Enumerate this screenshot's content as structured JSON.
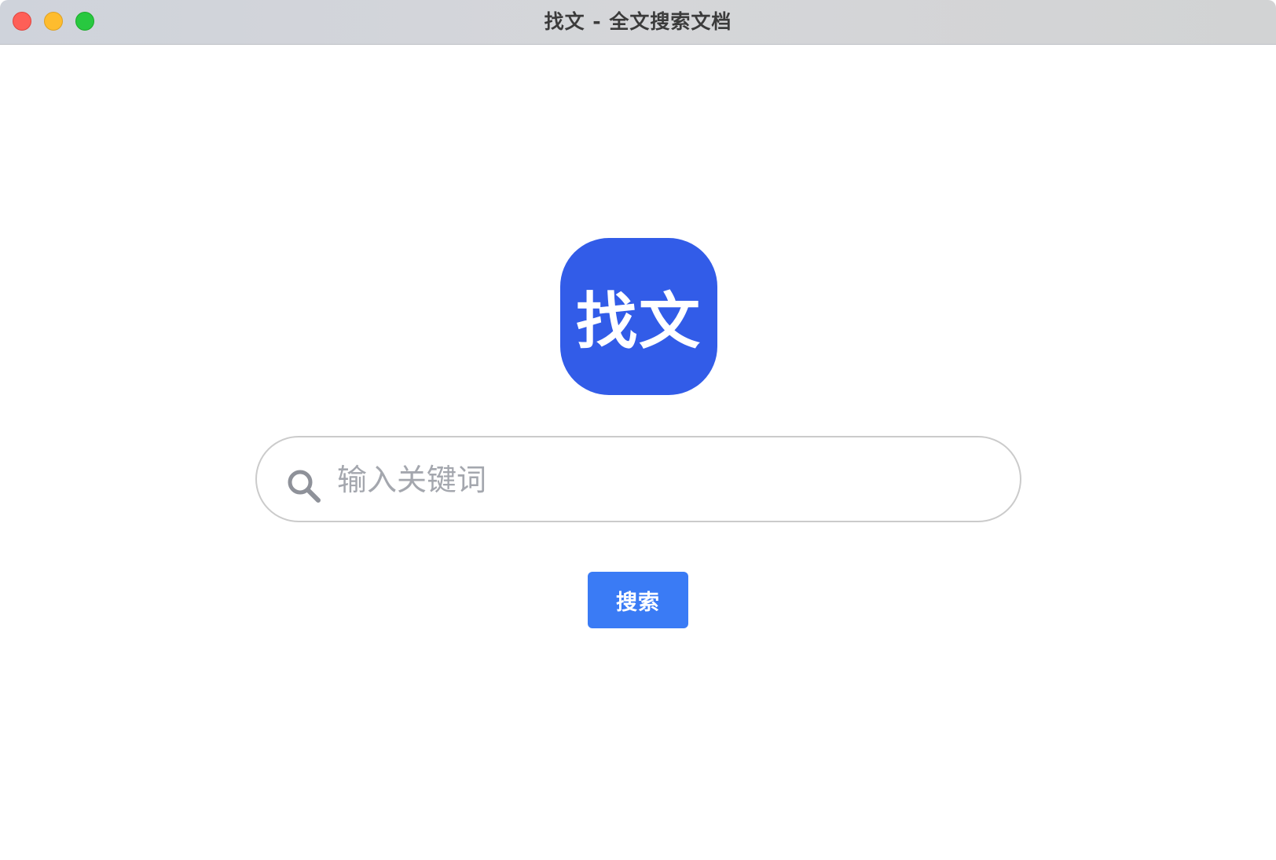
{
  "window": {
    "title": "找文 - 全文搜索文档"
  },
  "logo": {
    "text": "找文",
    "color": "#325CE8"
  },
  "search": {
    "placeholder": "输入关键词",
    "value": "",
    "icon": "search-icon"
  },
  "search_button": {
    "label": "搜索",
    "color": "#3A7BF5"
  }
}
